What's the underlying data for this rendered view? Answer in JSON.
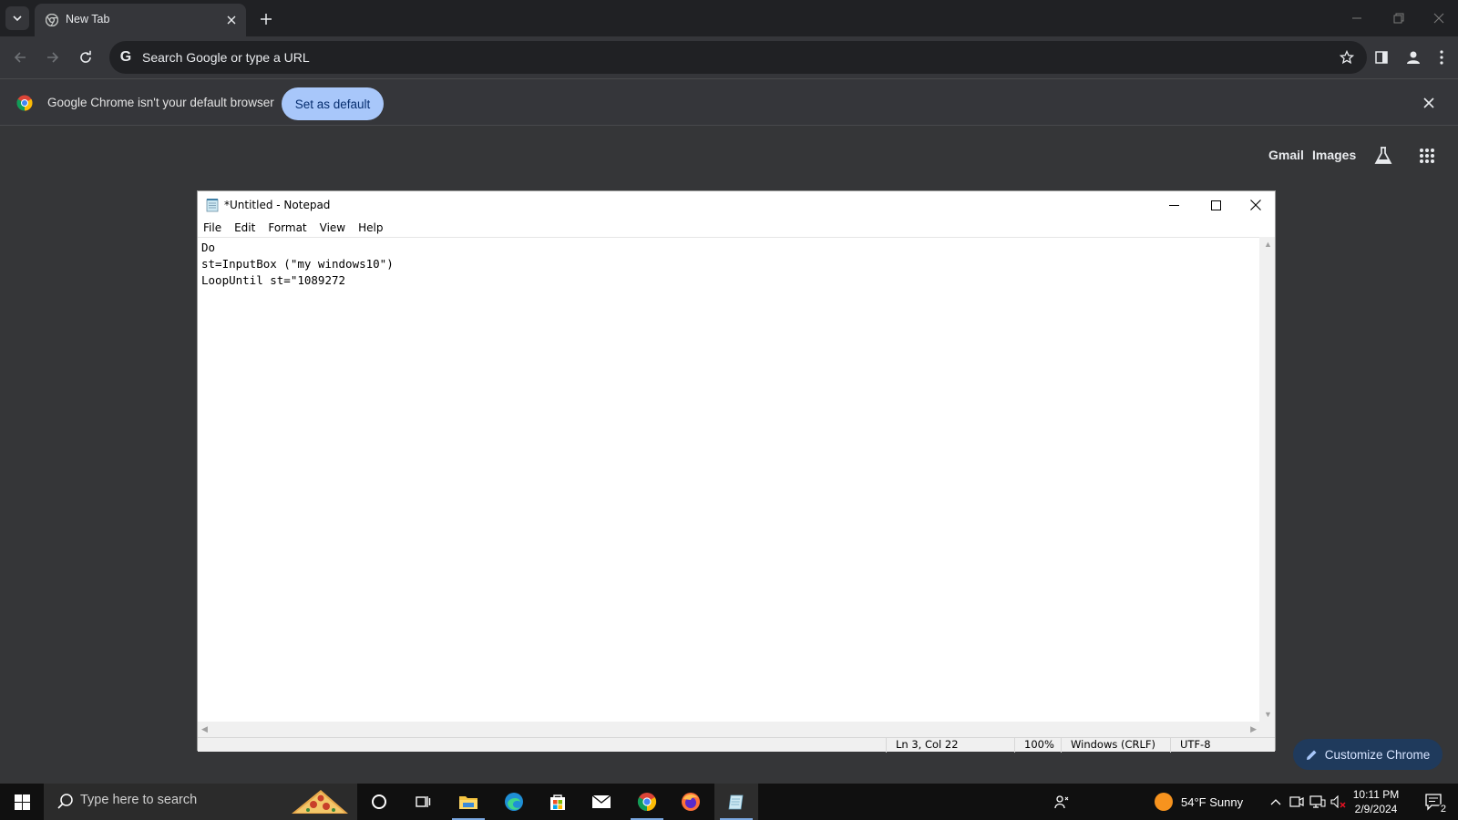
{
  "browser": {
    "tab_title": "New Tab",
    "omnibox_placeholder": "Search Google or type a URL",
    "infobar": {
      "message": "Google Chrome isn't your default browser",
      "button_label": "Set as default"
    },
    "ntp_links": {
      "gmail": "Gmail",
      "images": "Images"
    },
    "customize_label": "Customize Chrome"
  },
  "notepad": {
    "title": "*Untitled - Notepad",
    "menu": [
      "File",
      "Edit",
      "Format",
      "View",
      "Help"
    ],
    "content": "Do\nst=InputBox (\"my windows10\")\nLoopUntil st=\"1089272",
    "status": {
      "position": "Ln 3, Col 22",
      "zoom": "100%",
      "line_endings": "Windows (CRLF)",
      "encoding": "UTF-8"
    }
  },
  "taskbar": {
    "search_placeholder": "Type here to search",
    "weather": "54°F  Sunny",
    "time": "10:11 PM",
    "date": "2/9/2024",
    "notification_count": "2",
    "apps": [
      "cortana-icon",
      "task-view-icon",
      "file-explorer-icon",
      "edge-icon",
      "store-icon",
      "mail-icon",
      "chrome-icon",
      "firefox-icon",
      "notepad-icon"
    ]
  },
  "colors": {
    "chrome_bg": "#353638",
    "tabstrip": "#202124",
    "accent_button": "#a8c7fa",
    "taskbar": "#101010"
  }
}
